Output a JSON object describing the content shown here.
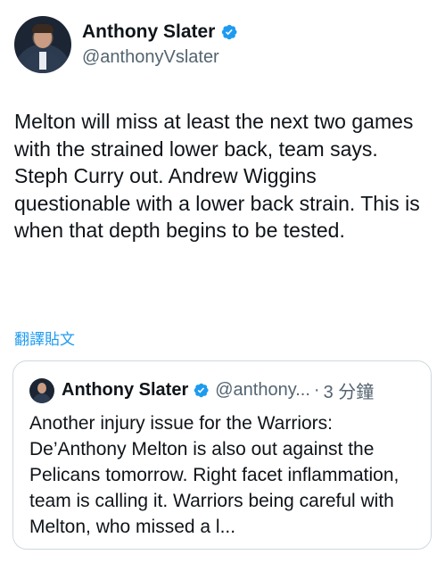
{
  "author": {
    "name": "Anthony Slater",
    "handle": "@anthonyVslater"
  },
  "tweet": {
    "text": "Melton will miss at least the next two games with the strained lower back, team says. Steph Curry out. Andrew Wiggins questionable with a lower back strain. This is when that depth begins to be tested."
  },
  "translate_label": "翻譯貼文",
  "quoted": {
    "name": "Anthony Slater",
    "handle": "@anthony...",
    "separator": "·",
    "time": "3 分鐘",
    "text": "Another injury issue for the Warriors: De’Anthony Melton is also out against the Pelicans tomorrow. Right facet inflammation, team is calling it. Warriors being careful with Melton, who missed a l..."
  },
  "colors": {
    "verified": "#1d9bf0",
    "link": "#1d9bf0",
    "secondary_text": "#536471",
    "border": "#cfd9de"
  },
  "icons": {
    "verified": "verified-badge-icon"
  }
}
